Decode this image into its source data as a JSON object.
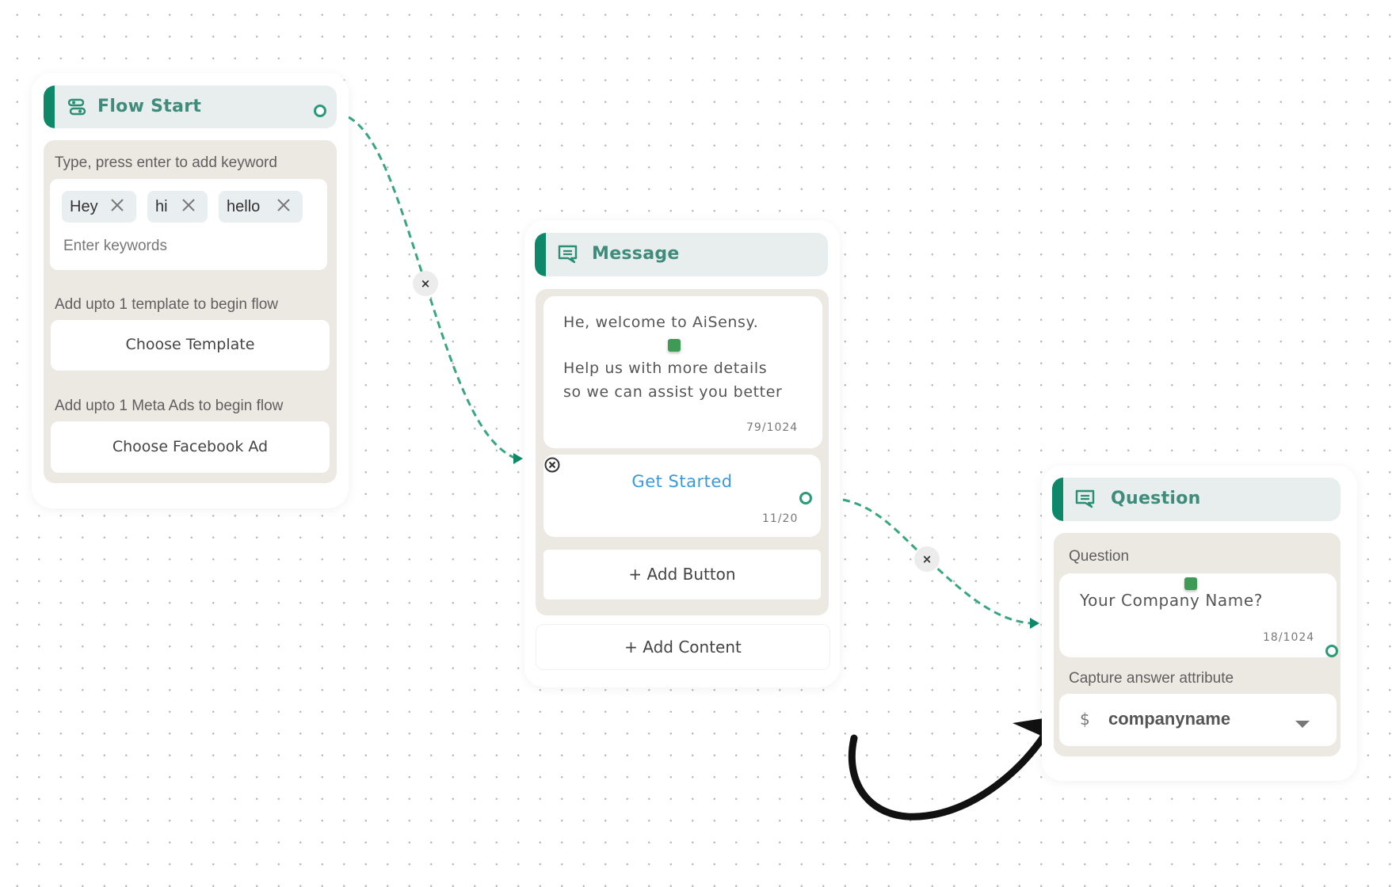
{
  "colors": {
    "accent": "#0e8868",
    "edge": "#3aa582",
    "header_bg": "#e8eded",
    "body_bg": "#ece9e3",
    "link": "#3b9ad9",
    "variable_marker": "#3f9a55"
  },
  "flow_start": {
    "icon": "flow-route-icon",
    "title": "Flow Start",
    "keyword_label": "Type, press enter to add keyword",
    "keywords": [
      {
        "text": "Hey",
        "remove_icon": "close-icon"
      },
      {
        "text": "hi",
        "remove_icon": "close-icon"
      },
      {
        "text": "hello",
        "remove_icon": "close-icon"
      }
    ],
    "keyword_placeholder": "Enter keywords",
    "template_label": "Add upto 1 template to begin flow",
    "template_button": "Choose Template",
    "ads_label": "Add upto 1 Meta Ads to begin flow",
    "ads_button": "Choose Facebook Ad"
  },
  "message_node": {
    "icon": "message-icon",
    "title": "Message",
    "text_line1": "He, welcome to AiSensy.",
    "text_line2": "Help us with more details",
    "text_line3": "so we can assist you better",
    "text_counter": "79/1024",
    "buttons": [
      {
        "label": "Get Started",
        "counter": "11/20",
        "remove_icon": "close-circle-icon"
      }
    ],
    "add_button": "+ Add Button",
    "add_content": "+ Add Content"
  },
  "question_node": {
    "icon": "message-icon",
    "title": "Question",
    "question_label": "Question",
    "question_text": "Your Company Name?",
    "question_counter": "18/1024",
    "capture_label": "Capture answer attribute",
    "attribute_prefix": "$",
    "attribute_value": "companyname",
    "dropdown_icon": "caret-down-icon"
  },
  "edges": [
    {
      "from": "flow_start",
      "to": "message_node",
      "delete_label": "×"
    },
    {
      "from": "message_node.get_started",
      "to": "question_node",
      "delete_label": "×"
    }
  ],
  "annotation": {
    "type": "curved-arrow",
    "points_to": "capture_answer_attribute"
  }
}
